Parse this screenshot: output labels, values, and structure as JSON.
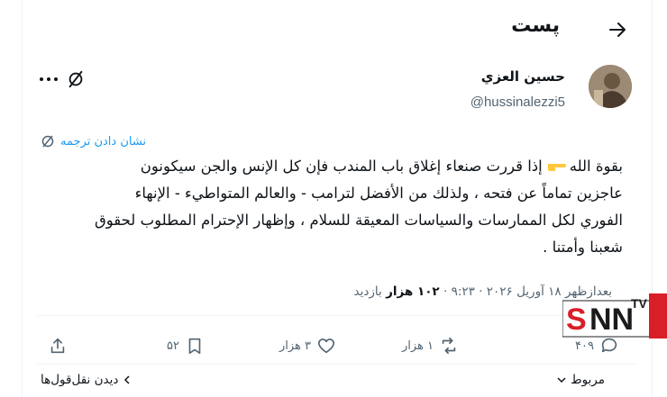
{
  "header": {
    "title": "پست"
  },
  "author": {
    "name": "حسين العزي",
    "handle": "@hussinalezzi5"
  },
  "translate": {
    "label": "نشان دادن ترجمه"
  },
  "tweet": {
    "line1_before": "بقوة الله",
    "line1_after": "إذا قررت صنعاء إغلاق باب المندب فإن كل الإنس والجن سيكونون",
    "line2": "عاجزين تماماً عن فتحه ، ولذلك من الأفضل لترامب - والعالم المتواطيء - الإنهاء",
    "line3": "الفوري لكل الممارسات والسياسات المعيقة للسلام ، وإظهار الإحترام المطلوب لحقوق",
    "line4": "شعبنا وأمتنا ."
  },
  "meta": {
    "time": "بعدازظهر ۱۸ آوریل ۲۰۲۶ · ۹:۲۳",
    "views_label": "بازدید",
    "views_count": "۱۰۲ هزار"
  },
  "actions": {
    "replies": "۴۰۹",
    "retweets": "۱ هزار",
    "likes": "۳ هزار",
    "bookmarks": "۵۲"
  },
  "footer": {
    "related": "مربوط",
    "view_quotes": "دیدن نقل‌قول‌ها"
  },
  "watermark": {
    "text": "SNN",
    "sub": "TV"
  },
  "colors": {
    "accent": "#1d9bf0",
    "text": "#0f1419",
    "muted": "#536471",
    "watermark_red": "#d81e26"
  }
}
